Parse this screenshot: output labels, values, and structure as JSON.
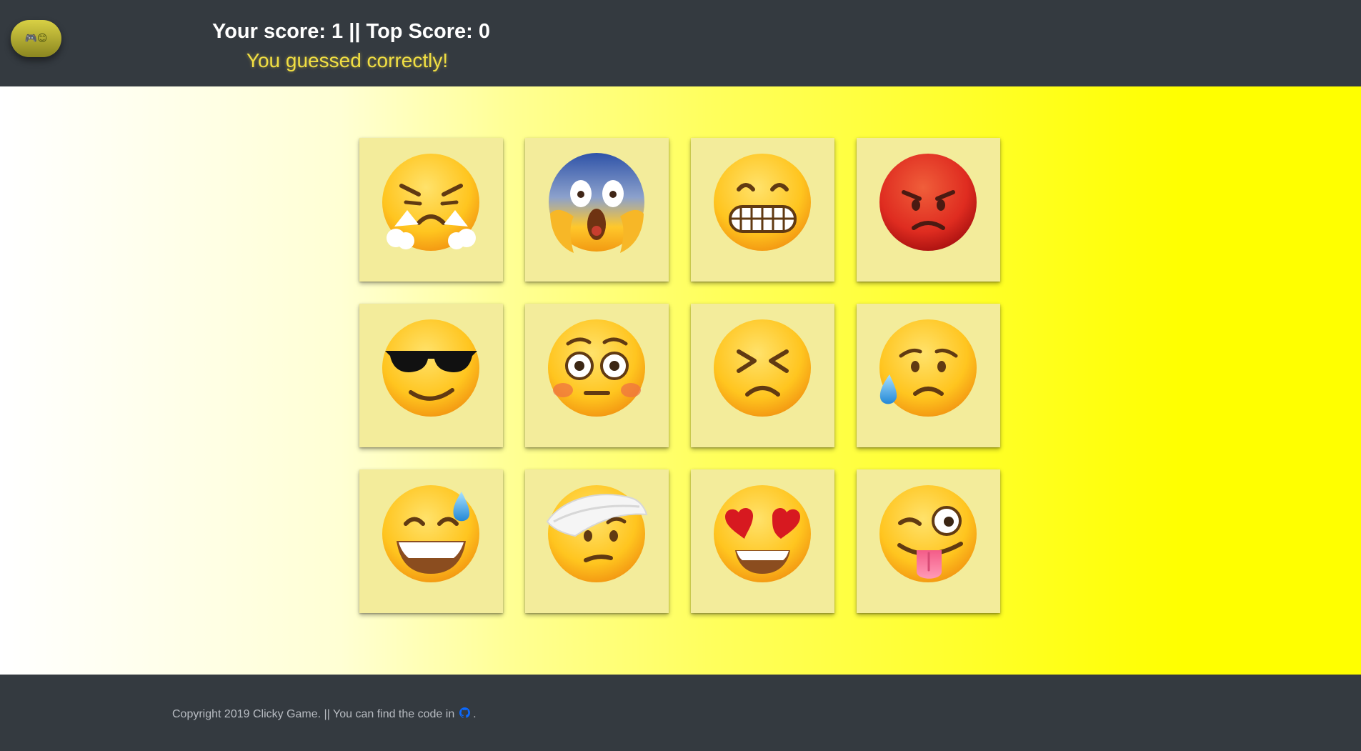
{
  "header": {
    "logo_icons": "🎮😊",
    "score_text": "Your score: 1 || Top Score: 0",
    "message": "You guessed correctly!"
  },
  "cards": [
    {
      "emoji": "steaming-angry-face"
    },
    {
      "emoji": "screaming-face"
    },
    {
      "emoji": "grimacing-face"
    },
    {
      "emoji": "red-angry-face"
    },
    {
      "emoji": "cool-sunglasses-face"
    },
    {
      "emoji": "flushed-face"
    },
    {
      "emoji": "persevering-face"
    },
    {
      "emoji": "anxious-sweat-face"
    },
    {
      "emoji": "grinning-sweat-face"
    },
    {
      "emoji": "bandaged-head-face"
    },
    {
      "emoji": "heart-eyes-face"
    },
    {
      "emoji": "winking-tongue-face"
    }
  ],
  "footer": {
    "copyright_text": "Copyright 2019 Clicky Game. || You can find the code in",
    "trailing_period": ".",
    "github_icon": "github-icon"
  },
  "colors": {
    "topbar": "#343a40",
    "score_text": "#ffffff",
    "message": "#f1df43",
    "card": "#f3ec9b",
    "github_icon": "#0b69ff"
  }
}
